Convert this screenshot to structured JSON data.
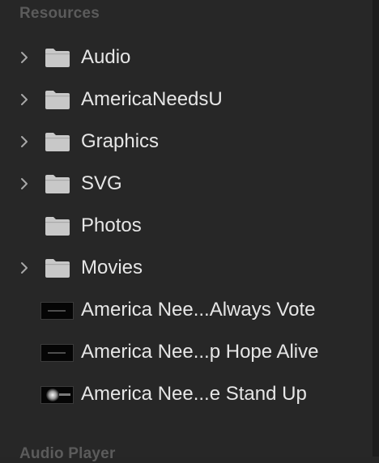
{
  "sections": {
    "resources_title": "Resources",
    "audio_player_title": "Audio Player"
  },
  "items": [
    {
      "label": "Audio",
      "kind": "folder",
      "expandable": true,
      "icon": "folder-icon"
    },
    {
      "label": "AmericaNeedsU",
      "kind": "folder",
      "expandable": true,
      "icon": "folder-icon"
    },
    {
      "label": "Graphics",
      "kind": "folder",
      "expandable": true,
      "icon": "folder-icon"
    },
    {
      "label": "SVG",
      "kind": "folder",
      "expandable": true,
      "icon": "folder-icon"
    },
    {
      "label": "Photos",
      "kind": "folder",
      "expandable": false,
      "icon": "folder-icon"
    },
    {
      "label": "Movies",
      "kind": "folder",
      "expandable": true,
      "icon": "folder-icon"
    },
    {
      "label": "America Nee...Always Vote",
      "kind": "movie",
      "expandable": false,
      "icon": "movie-thumbnail"
    },
    {
      "label": "America Nee...p Hope Alive",
      "kind": "movie",
      "expandable": false,
      "icon": "movie-thumbnail"
    },
    {
      "label": "America Nee...e Stand Up",
      "kind": "movie",
      "expandable": false,
      "icon": "movie-thumbnail-glow"
    }
  ],
  "colors": {
    "background": "#272727",
    "header_text": "#5b5b5b",
    "item_text": "#e6e6e6",
    "folder_icon": "#c8c8c8",
    "chevron": "#a8a8a8"
  }
}
